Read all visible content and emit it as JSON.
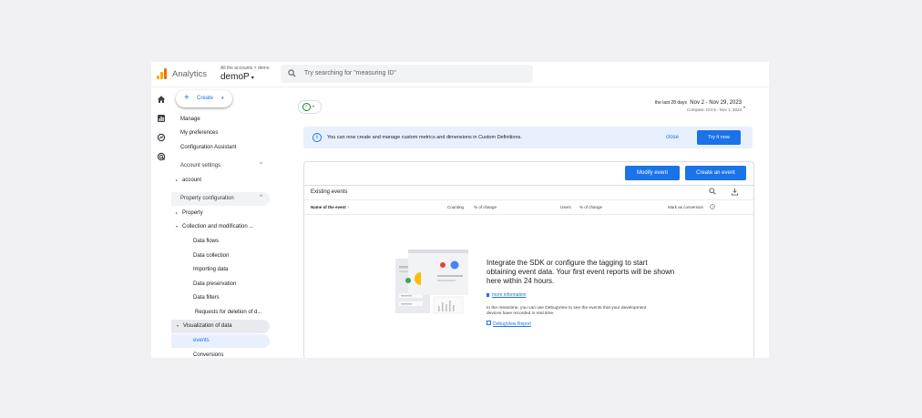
{
  "app": {
    "title": "Analytics",
    "breadcrumb": "All the accounts > demo",
    "property": "demoP",
    "property_caret": "▾",
    "brand_colors": [
      "#f9ab00",
      "#e37400"
    ]
  },
  "search": {
    "placeholder": "Try searching for \"measuring ID\"",
    "icon": "search-icon"
  },
  "rail": {
    "icons": [
      "home-icon",
      "reports-icon",
      "explore-icon",
      "advertising-icon"
    ]
  },
  "nav": {
    "create_label": "Create",
    "create_plus": "+",
    "create_caret": "▾",
    "manage": "Manage",
    "preferences": "My preferences",
    "config_assistant": "Configuration Assistant",
    "account_settings": "Account settings",
    "account": "account",
    "property_config": "Property configuration",
    "property": "Property",
    "collection": "Collection and modification ...",
    "sub": [
      "Data flows",
      "Data collection",
      "Importing data",
      "Data preservation",
      "Data filters",
      "Requests for deletion of d..."
    ],
    "visualization": "Visualization of data",
    "events": "events",
    "conversions": "Conversions",
    "chevron_up": "^",
    "tri_right": "▸",
    "tri_down": "▾"
  },
  "toolbar": {
    "filter_check": "✓",
    "filter_caret": "▾",
    "date_label": "the last 28 days",
    "date_range": "Nov 2 - Nov 29, 2023",
    "compare": "Compare: Oct 5 - Nov 1, 2023",
    "date_caret": "▾"
  },
  "banner": {
    "icon_glyph": "i",
    "text": "You can now create and manage custom metrics and dimensions in Custom Definitions.",
    "close": "close",
    "try": "Try it now"
  },
  "events_card": {
    "modify": "Modify event",
    "create": "Create an event",
    "table_title": "Existing events",
    "columns": [
      "Name of the event",
      "Counting",
      "% of change",
      "Users",
      "% of change",
      "Mark as conversion"
    ],
    "sort_arrow": "↑",
    "empty_title": "Integrate the SDK or configure the tagging to start obtaining event data. Your first event reports will be shown here within 24 hours.",
    "more_info": "more information",
    "note": "In the meantime, you can use DebugView to see the events that your development devices have recorded in real time.",
    "debugview": "DebugView Report"
  },
  "colors": {
    "accent": "#1a73e8",
    "banner_bg": "#e8f0fe",
    "selected_bg": "#e8f0fe",
    "section_bg": "#f1f3f4",
    "ok_green": "#188038"
  }
}
